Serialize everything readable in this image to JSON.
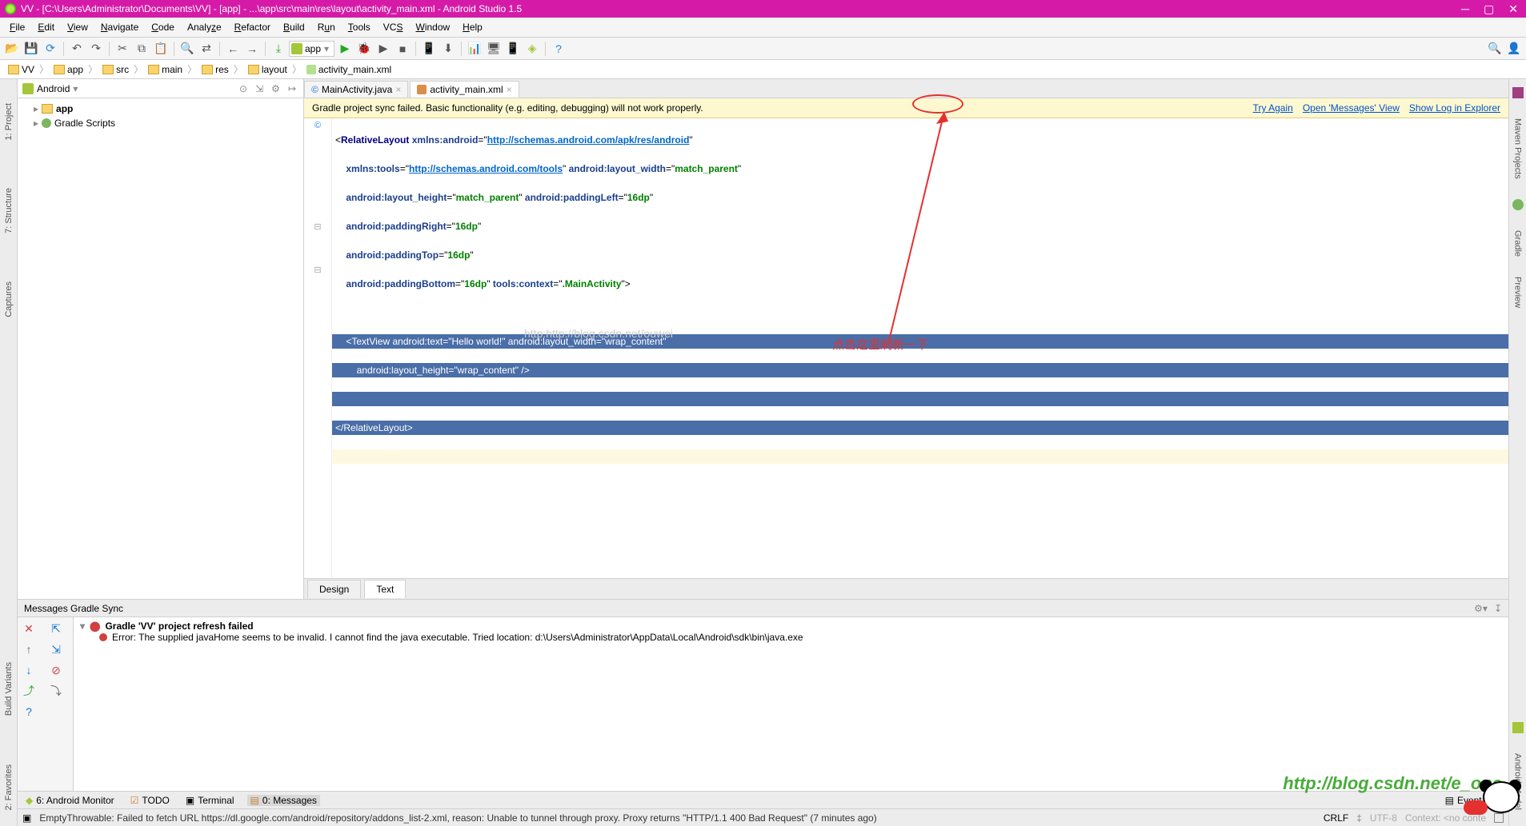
{
  "titlebar": {
    "text": "VV - [C:\\Users\\Administrator\\Documents\\VV] - [app] - ...\\app\\src\\main\\res\\layout\\activity_main.xml - Android Studio 1.5"
  },
  "menu": [
    "File",
    "Edit",
    "View",
    "Navigate",
    "Code",
    "Analyze",
    "Refactor",
    "Build",
    "Run",
    "Tools",
    "VCS",
    "Window",
    "Help"
  ],
  "runconfig": "app",
  "breadcrumbs": [
    "VV",
    "app",
    "src",
    "main",
    "res",
    "layout",
    "activity_main.xml"
  ],
  "project": {
    "header": "Android",
    "nodes": [
      {
        "label": "app",
        "icon": "folder"
      },
      {
        "label": "Gradle Scripts",
        "icon": "gradle"
      }
    ]
  },
  "editor": {
    "tabs": [
      {
        "label": "MainActivity.java",
        "active": false,
        "icon": "java"
      },
      {
        "label": "activity_main.xml",
        "active": true,
        "icon": "xml"
      }
    ],
    "banner": {
      "message": "Gradle project sync failed. Basic functionality (e.g. editing, debugging) will not work properly.",
      "links": [
        "Try Again",
        "Open 'Messages' View",
        "Show Log in Explorer"
      ]
    },
    "bottabs": [
      "Design",
      "Text"
    ],
    "bottabs_active": "Text",
    "watermark": "http:http://blog.csdn.net/ouwei",
    "code": {
      "l1_tag": "RelativeLayout",
      "l1_attr": "xmlns:android",
      "l1_val": "http://schemas.android.com/apk/res/android",
      "l2_attr": "xmlns:tools",
      "l2_val": "http://schemas.android.com/tools",
      "l2_attr2": "android:layout_width",
      "l2_val2": "match_parent",
      "l3_attr": "android:layout_height",
      "l3_val": "match_parent",
      "l3_attr2": "android:paddingLeft",
      "l3_val2": "16dp",
      "l4_attr": "android:paddingRight",
      "l4_val": "16dp",
      "l5_attr": "android:paddingTop",
      "l5_val": "16dp",
      "l6_attr": "android:paddingBottom",
      "l6_val": "16dp",
      "l6_attr2": "tools:context",
      "l6_val2": ".MainActivity",
      "l8_tag": "TextView",
      "l8_attr": "android:text",
      "l8_val": "Hello world!",
      "l8_attr2": "android:layout_width",
      "l8_val2": "wrap_content",
      "l9_attr": "android:layout_height",
      "l9_val": "wrap_content",
      "l11": "</RelativeLayout>"
    }
  },
  "messages": {
    "header": "Messages Gradle Sync",
    "error_title": "Gradle 'VV' project refresh failed",
    "error_body": "Error: The supplied javaHome seems to be invalid. I cannot find the java executable. Tried location: d:\\Users\\Administrator\\AppData\\Local\\Android\\sdk\\bin\\java.exe"
  },
  "lefttabs": [
    "1: Project",
    "7: Structure",
    "Captures"
  ],
  "righttabs": [
    "Maven Projects",
    "Gradle",
    "Preview"
  ],
  "right_bottom_tab": "Android Model",
  "bottomtools": [
    "6: Android Monitor",
    "TODO",
    "Terminal",
    "0: Messages"
  ],
  "bottomtools_right": "Event Log",
  "left_bottom_tabs": [
    "Build Variants",
    "2: Favorites"
  ],
  "status": {
    "message": "EmptyThrowable: Failed to fetch URL https://dl.google.com/android/repository/addons_list-2.xml, reason: Unable to tunnel through proxy. Proxy returns \"HTTP/1.1 400 Bad Request\" (7 minutes ago)",
    "crlf": "CRLF",
    "enc": "UTF-8",
    "ctx": "Context: <no conte"
  },
  "annotation": "点击这里刷新一下",
  "watermark2": "http://blog.csdn.net/e_one"
}
